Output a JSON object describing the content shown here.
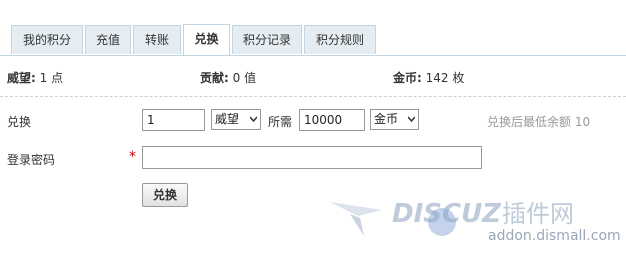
{
  "tabs": [
    {
      "label": "我的积分",
      "active": false
    },
    {
      "label": "充值",
      "active": false
    },
    {
      "label": "转账",
      "active": false
    },
    {
      "label": "兑换",
      "active": true
    },
    {
      "label": "积分记录",
      "active": false
    },
    {
      "label": "积分规则",
      "active": false
    }
  ],
  "stats": {
    "prestige_label": "威望:",
    "prestige_value": "1 点",
    "contribution_label": "贡献:",
    "contribution_value": "0 值",
    "coins_label": "金币:",
    "coins_value": "142 枚"
  },
  "exchange": {
    "label": "兑换",
    "amount_value": "1",
    "from_unit": "威望",
    "needs_label": "所需",
    "needs_value": "10000",
    "to_unit": "金币",
    "hint": "兑换后最低余额 10"
  },
  "password": {
    "label": "登录密码",
    "required_mark": "*",
    "value": ""
  },
  "submit_label": "兑换",
  "watermark": {
    "text": "DISCUZ 插件网",
    "url": "addon.dismall.com"
  },
  "colors": {
    "tab_bg": "#e5edf2",
    "tab_border": "#c2d5e3",
    "required": "#cc0000",
    "hint": "#999999"
  }
}
